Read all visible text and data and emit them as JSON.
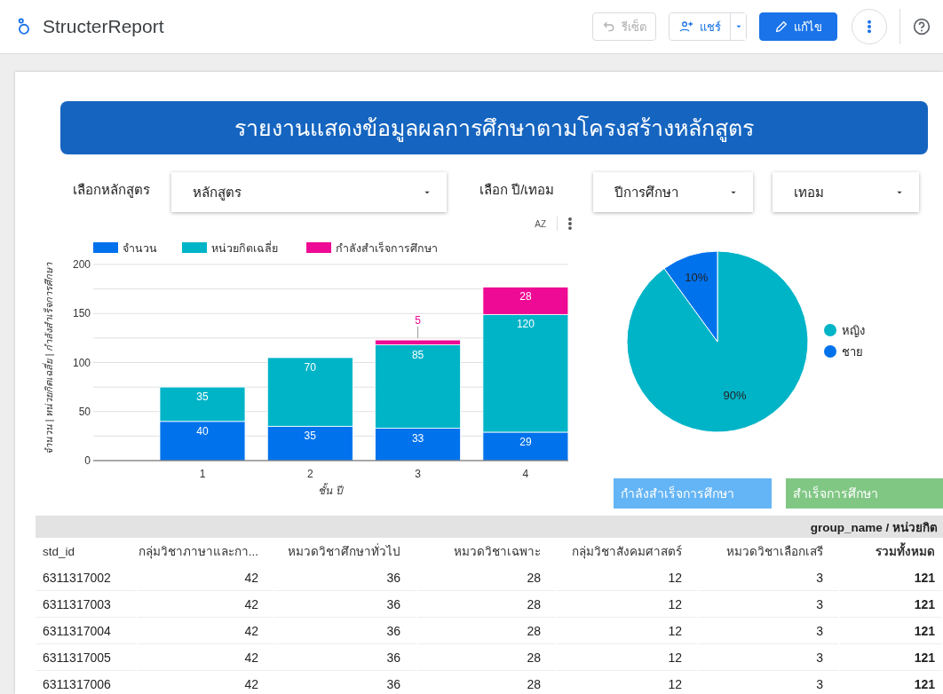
{
  "app": {
    "title": "StructerReport"
  },
  "toolbar": {
    "buttons": [
      {
        "kind": "reset",
        "label": "รีเซ็ต",
        "disabled": true
      },
      {
        "kind": "share",
        "label": "แชร์",
        "disabled": false
      },
      {
        "kind": "edit",
        "label": "แก้ไข",
        "disabled": false
      }
    ]
  },
  "report": {
    "title": "รายงานแสดงข้อมูลผลการศึกษาตามโครงสร้างหลักสูตร",
    "filters": [
      {
        "label": "เลือกหลักสูตร",
        "dropdowns": [
          "หลักสูตร"
        ]
      },
      {
        "label": "เลือก ปี/เทอม",
        "dropdowns": [
          "ปีการศึกษา",
          "เทอม"
        ]
      }
    ],
    "sort_icon": "AZ",
    "bar_chart": {
      "chart_data": {
        "type": "bar",
        "stacked": true,
        "grid": true,
        "legend": true,
        "xlabel": "ชั้น ปี",
        "ylabel": "จำนวน | หน่วยกิตเฉลี่ย | กำลังสำเร็จการศึกษา",
        "categories": [
          "1",
          "2",
          "3",
          "4"
        ],
        "ylim": [
          0,
          200
        ],
        "yticks": [
          0,
          50,
          100,
          150,
          200
        ],
        "data_labels": true,
        "series": [
          {
            "name": "จำนวน",
            "color": "#0072ec",
            "values": [
              40,
              35,
              33,
              29
            ]
          },
          {
            "name": "หน่วยกิตเฉลี่ย",
            "color": "#00b4c8",
            "values": [
              35,
              70,
              85,
              120
            ]
          },
          {
            "name": "กำลังสำเร็จการศึกษา",
            "color": "#ee0a94",
            "values": [
              null,
              null,
              5,
              28
            ]
          }
        ]
      }
    },
    "pie_chart": {
      "chart_data": {
        "type": "pie",
        "legend": true,
        "categories": [
          "หญิง",
          "ชาย"
        ],
        "values": [
          90,
          10
        ],
        "value_labels": [
          "90%",
          "10%"
        ],
        "colors": [
          "#00b4c8",
          "#0072ec"
        ]
      }
    },
    "status_buttons": [
      {
        "label": "กำลังสำเร็จการศึกษา",
        "color": "#64b5f6"
      },
      {
        "label": "สำเร็จการศึกษา",
        "color": "#81c784"
      }
    ],
    "table_group_header": "group_name / หน่วยกิต",
    "table": {
      "columns": [
        "std_id",
        "กลุ่มวิชาภาษาและกา...",
        "หมวดวิชาศึกษาทั่วไป",
        "หมวดวิชาเฉพาะ",
        "กลุ่มวิชาสังคมศาสตร์",
        "หมวดวิชาเลือกเสรี",
        "รวมทั้งหมด"
      ],
      "rows": [
        [
          "6311317002",
          "42",
          "36",
          "28",
          "12",
          "3",
          "121"
        ],
        [
          "6311317003",
          "42",
          "36",
          "28",
          "12",
          "3",
          "121"
        ],
        [
          "6311317004",
          "42",
          "36",
          "28",
          "12",
          "3",
          "121"
        ],
        [
          "6311317005",
          "42",
          "36",
          "28",
          "12",
          "3",
          "121"
        ],
        [
          "6311317006",
          "42",
          "36",
          "28",
          "12",
          "3",
          "121"
        ]
      ]
    }
  }
}
